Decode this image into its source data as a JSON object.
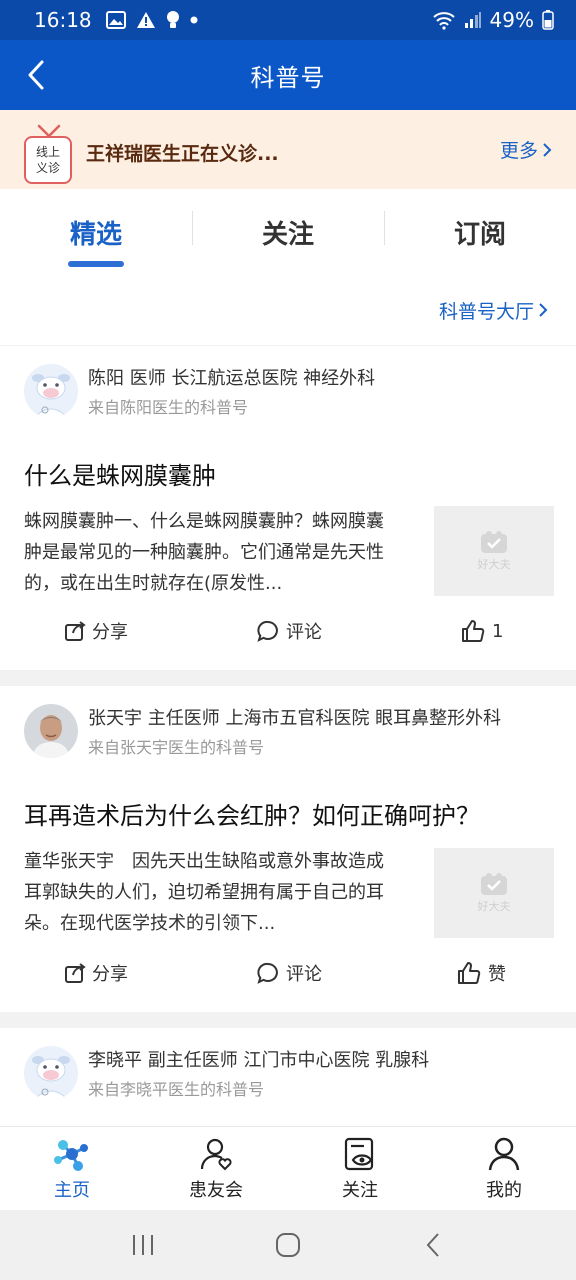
{
  "status_bar": {
    "time": "16:18",
    "battery": "49%"
  },
  "nav": {
    "title": "科普号"
  },
  "banner": {
    "badge_text": "线上义诊",
    "message": "王祥瑞医生正在义诊...",
    "more": "更多"
  },
  "tabs": [
    {
      "label": "精选",
      "active": true
    },
    {
      "label": "关注",
      "active": false
    },
    {
      "label": "订阅",
      "active": false
    }
  ],
  "hall_link": "科普号大厅",
  "posts": [
    {
      "author": "陈阳 医师 长江航运总医院 神经外科",
      "source": "来自陈阳医生的科普号",
      "title": "什么是蛛网膜囊肿",
      "excerpt": "蛛网膜囊肿一、什么是蛛网膜囊肿？蛛网膜囊肿是最常见的一种脑囊肿。它们通常是先天性的，或在出生时就存在(原发性...",
      "thumb_text": "好大夫",
      "share": "分享",
      "comment": "评论",
      "like": "1"
    },
    {
      "author": "张天宇 主任医师 上海市五官科医院 眼耳鼻整形外科",
      "source": "来自张天宇医生的科普号",
      "title": "耳再造术后为什么会红肿？如何正确呵护？",
      "excerpt": "童华张天宇　因先天出生缺陷或意外事故造成耳郭缺失的人们，迫切希望拥有属于自己的耳朵。在现代医学技术的引领下...",
      "thumb_text": "好大夫",
      "share": "分享",
      "comment": "评论",
      "like": "赞"
    },
    {
      "author": "李晓平 副主任医师 江门市中心医院 乳腺科",
      "source": "来自李晓平医生的科普号"
    }
  ],
  "bottom_nav": [
    {
      "label": "主页",
      "icon": "home-molecule-icon",
      "active": true
    },
    {
      "label": "患友会",
      "icon": "patient-group-icon",
      "active": false
    },
    {
      "label": "关注",
      "icon": "follow-eye-icon",
      "active": false
    },
    {
      "label": "我的",
      "icon": "profile-icon",
      "active": false
    }
  ],
  "colors": {
    "header": "#0b57c8",
    "accent": "#1a62c6",
    "banner_bg": "#fdf0e3"
  }
}
